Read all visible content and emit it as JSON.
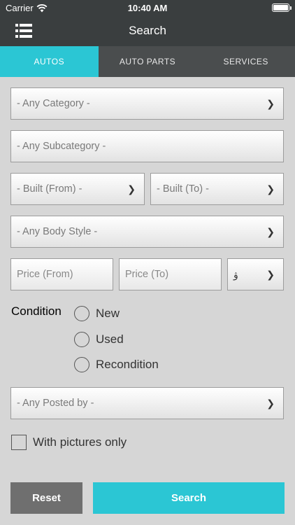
{
  "status": {
    "carrier": "Carrier",
    "time": "10:40 AM"
  },
  "header": {
    "title": "Search"
  },
  "tabs": [
    {
      "label": "AUTOS",
      "active": true
    },
    {
      "label": "AUTO PARTS",
      "active": false
    },
    {
      "label": "SERVICES",
      "active": false
    }
  ],
  "form": {
    "category": "- Any Category -",
    "subcategory": "- Any Subcategory -",
    "built_from": "- Built (From) -",
    "built_to": "- Built (To) -",
    "body_style": "- Any Body Style -",
    "price_from_placeholder": "Price (From)",
    "price_to_placeholder": "Price (To)",
    "currency": "ۋ",
    "condition_label": "Condition",
    "conditions": [
      "New",
      "Used",
      "Recondition"
    ],
    "posted_by": "- Any Posted by -",
    "pictures_only": "With pictures only"
  },
  "buttons": {
    "reset": "Reset",
    "search": "Search"
  },
  "colors": {
    "accent": "#2bc6d4",
    "header": "#3a3e3f",
    "tab_bar": "#4a4d4e",
    "reset": "#6f6f6f",
    "background": "#d6d6d6"
  },
  "icons": {
    "menu": "list-menu-icon",
    "chevron": "chevron-right-icon",
    "wifi": "wifi-icon",
    "battery": "battery-icon"
  }
}
